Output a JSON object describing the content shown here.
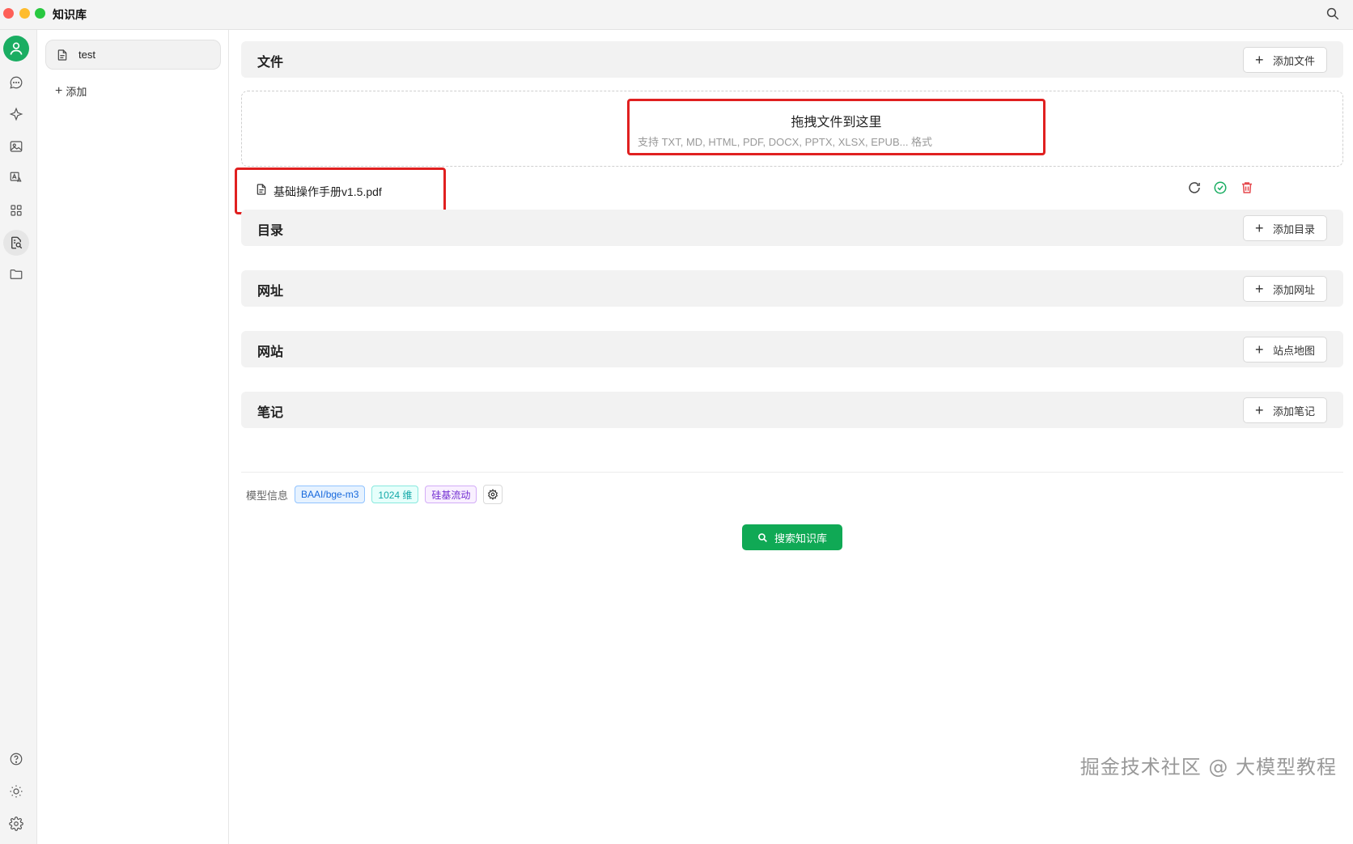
{
  "window": {
    "title": "知识库"
  },
  "knowledge_bases": {
    "items": [
      {
        "label": "test"
      }
    ],
    "add_label": "添加"
  },
  "sections": {
    "files": {
      "title": "文件",
      "button": "添加文件"
    },
    "directory": {
      "title": "目录",
      "button": "添加目录"
    },
    "urls": {
      "title": "网址",
      "button": "添加网址"
    },
    "website": {
      "title": "网站",
      "button": "站点地图"
    },
    "notes": {
      "title": "笔记",
      "button": "添加笔记"
    }
  },
  "dropzone": {
    "title": "拖拽文件到这里",
    "subtitle": "支持 TXT, MD, HTML, PDF, DOCX, PPTX, XLSX, EPUB... 格式"
  },
  "files": [
    {
      "name": "基础操作手册v1.5.pdf"
    }
  ],
  "model_info": {
    "label": "模型信息",
    "model": "BAAI/bge-m3",
    "dimensions": "1024 维",
    "provider": "硅基流动"
  },
  "search_button": "搜索知识库",
  "watermark": "掘金技术社区 @ 大模型教程",
  "colors": {
    "accent": "#10a955",
    "highlight_box": "#e02020"
  }
}
